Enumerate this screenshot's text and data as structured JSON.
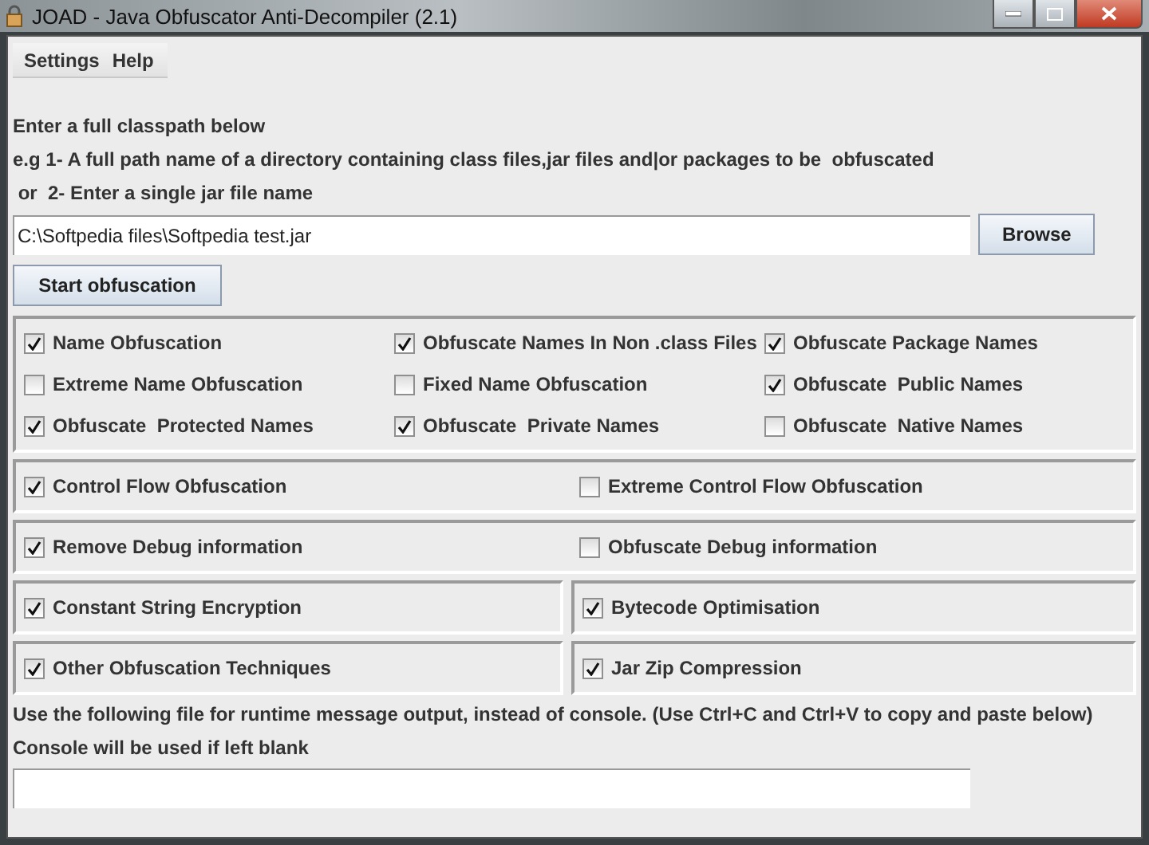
{
  "window": {
    "title": "JOAD - Java Obfuscator Anti-Decompiler (2.1)"
  },
  "menu": [
    {
      "label": "Settings"
    },
    {
      "label": "Help"
    }
  ],
  "instructions": [
    "Enter a full classpath below",
    "e.g 1- A full path name of a directory containing class files,jar files and|or packages to be  obfuscated",
    " or  2- Enter a single jar file name"
  ],
  "classpath": {
    "value": "C:\\Softpedia files\\Softpedia test.jar",
    "button": "Browse"
  },
  "start_button": "Start obfuscation",
  "name_options": [
    {
      "label": "Name Obfuscation",
      "checked": true
    },
    {
      "label": "Obfuscate Names In Non .class Files",
      "checked": true
    },
    {
      "label": "Obfuscate Package Names",
      "checked": true
    },
    {
      "label": "Extreme Name Obfuscation",
      "checked": false
    },
    {
      "label": "Fixed Name Obfuscation",
      "checked": false
    },
    {
      "label": "Obfuscate  Public Names",
      "checked": true
    },
    {
      "label": "Obfuscate  Protected Names",
      "checked": true
    },
    {
      "label": "Obfuscate  Private Names",
      "checked": true
    },
    {
      "label": "Obfuscate  Native Names",
      "checked": false
    }
  ],
  "option_groups": [
    {
      "kind": "shared",
      "options": [
        {
          "label": "Control Flow Obfuscation",
          "checked": true
        },
        {
          "label": "Extreme Control Flow Obfuscation",
          "checked": false
        }
      ]
    },
    {
      "kind": "shared",
      "options": [
        {
          "label": "Remove Debug information",
          "checked": true
        },
        {
          "label": "Obfuscate Debug information",
          "checked": false
        }
      ]
    },
    {
      "kind": "split",
      "options": [
        {
          "label": "Constant String Encryption",
          "checked": true
        },
        {
          "label": "Bytecode Optimisation",
          "checked": true
        }
      ]
    },
    {
      "kind": "split",
      "options": [
        {
          "label": "Other Obfuscation Techniques",
          "checked": true
        },
        {
          "label": "Jar Zip Compression",
          "checked": true
        }
      ]
    }
  ],
  "output": {
    "lines": [
      "Use the following file for runtime message output, instead of console. (Use Ctrl+C and Ctrl+V to copy and paste below)",
      "Console will be used if left blank"
    ]
  }
}
